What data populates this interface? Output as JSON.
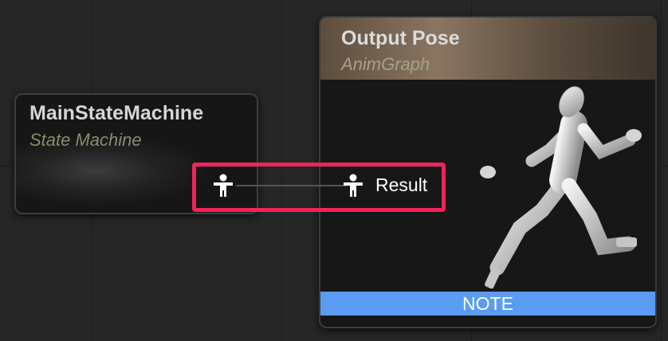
{
  "state_machine_node": {
    "title": "MainStateMachine",
    "subtitle": "State Machine",
    "output_pin_icon": "pose-pin-icon"
  },
  "output_pose_node": {
    "title": "Output Pose",
    "subtitle": "AnimGraph",
    "input_pin_icon": "pose-pin-icon",
    "input_pin_label": "Result",
    "preview_icon": "running-mannequin",
    "note_label": "NOTE"
  },
  "connection": {
    "highlight_color": "#f0235a",
    "wire_color": "#555555"
  },
  "colors": {
    "note_bar": "#5b9bf3",
    "subtitle_text": "#8e8b6e"
  }
}
